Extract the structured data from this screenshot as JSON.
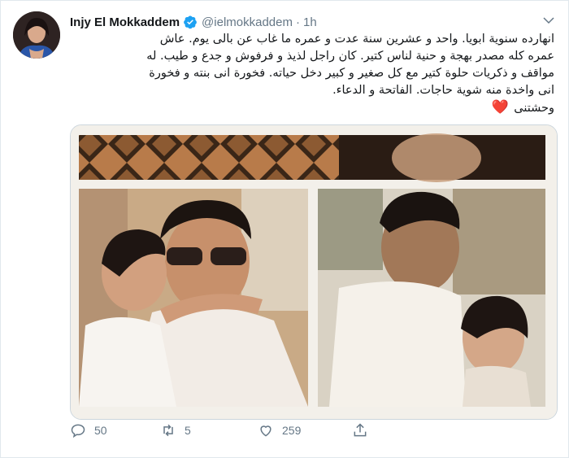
{
  "tweet": {
    "author_name": "Injy El Mokkaddem",
    "handle": "@ielmokkaddem",
    "separator": "·",
    "time": "1h",
    "text_lines": [
      "انهارده سنوية ابويا. واحد و عشرين سنة عدت و عمره ما غاب عن بالى يوم. عاش",
      "عمره كله مصدر بهجة و حنية لناس كتير. كان راجل لذيذ و فرفوش و جدع و طيب. له",
      "مواقف و ذكريات حلوة كتير مع كل صغير و كبير دخل حياته. فخورة انى بنته و فخورة",
      "انى واخدة منه شوية حاجات. الفاتحة و الدعاء.",
      "وحشتنى"
    ],
    "heart_emoji": "❤️",
    "actions": {
      "replies": "50",
      "retweets": "5",
      "likes": "259"
    }
  },
  "icons": {
    "verified": "verified-badge-icon",
    "caret": "chevron-down-icon",
    "reply": "reply-icon",
    "retweet": "retweet-icon",
    "like": "heart-icon",
    "share": "share-icon"
  },
  "colors": {
    "accent": "#1da1f2",
    "secondary_text": "#657786",
    "heart": "#e0245e"
  }
}
